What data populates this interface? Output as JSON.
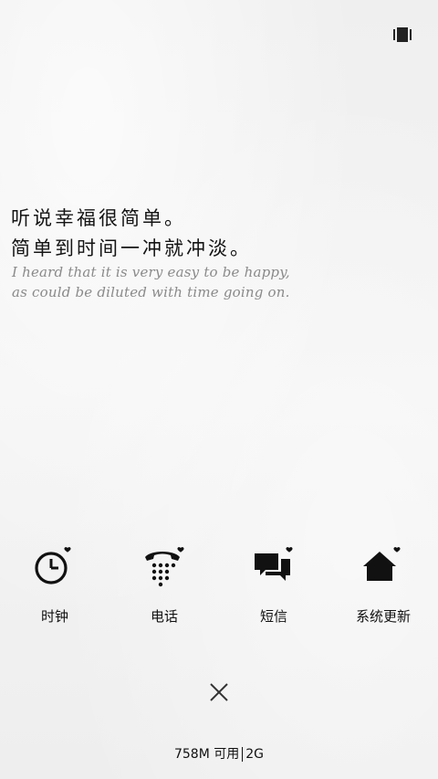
{
  "top_bar": {
    "icon": "recents-icon"
  },
  "quote": {
    "cn_line1": "听说幸福很简单。",
    "cn_line2": "简单到时间一冲就冲淡。",
    "en_line1": "I heard that it is very easy to be happy,",
    "en_line2": "as could be diluted with time going on."
  },
  "apps": [
    {
      "label": "时钟",
      "icon": "clock-icon"
    },
    {
      "label": "电话",
      "icon": "phone-icon"
    },
    {
      "label": "短信",
      "icon": "messages-icon"
    },
    {
      "label": "系统更新",
      "icon": "home-update-icon"
    }
  ],
  "close": {
    "icon": "close-icon"
  },
  "memory": {
    "available": "758M 可用",
    "total": "2G"
  }
}
